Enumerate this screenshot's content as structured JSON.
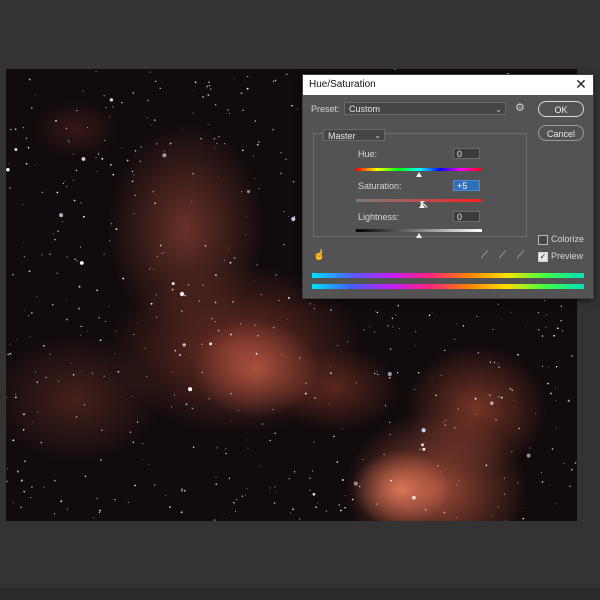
{
  "dialog": {
    "title": "Hue/Saturation",
    "close_glyph": "✕",
    "preset_label": "Preset:",
    "preset_value": "Custom",
    "ok_label": "OK",
    "cancel_label": "Cancel",
    "channel_value": "Master",
    "hue_label": "Hue:",
    "hue_value": "0",
    "saturation_label": "Saturation:",
    "saturation_value": "+5",
    "lightness_label": "Lightness:",
    "lightness_value": "0",
    "colorize_label": "Colorize",
    "colorize_checked": false,
    "preview_label": "Preview",
    "preview_checked": true,
    "slider_levels": {
      "hue": 0.5,
      "saturation": 0.52,
      "lightness": 0.5
    }
  },
  "icons": {
    "gear": "gear-icon",
    "hand": "on-image-adjust-hand-icon",
    "eyedroppers": [
      "eyedropper-icon",
      "eyedropper-plus-icon",
      "eyedropper-minus-icon"
    ],
    "cursor": "mouse-pointer-icon"
  },
  "colors": {
    "app_background": "#333333",
    "dialog_background": "#535353",
    "selected_field": "#2f6fb8"
  }
}
